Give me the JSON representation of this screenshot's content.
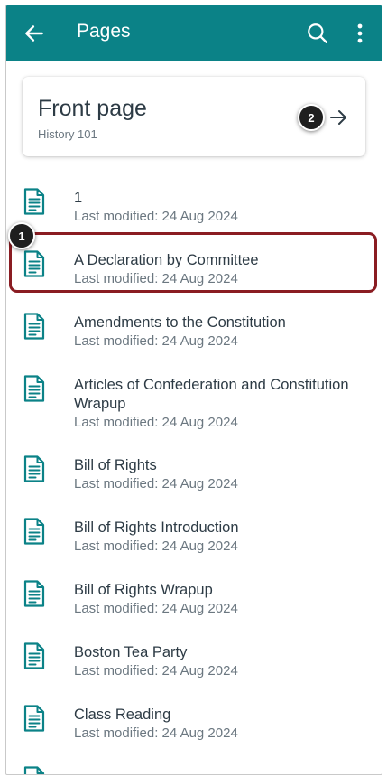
{
  "appbar": {
    "title": "Pages",
    "back_icon": "arrow-left-icon",
    "search_icon": "search-icon",
    "more_icon": "more-vertical-icon",
    "color": "#0b8287"
  },
  "front_page": {
    "title": "Front page",
    "subtitle": "History 101",
    "arrow_icon": "arrow-right-icon"
  },
  "callouts": {
    "one": "1",
    "two": "2"
  },
  "pages": [
    {
      "name": "1",
      "modified": "Last modified: 24 Aug 2024"
    },
    {
      "name": "A Declaration by Committee",
      "modified": "Last modified: 24 Aug 2024"
    },
    {
      "name": "Amendments to the Constitution",
      "modified": "Last modified: 24 Aug 2024"
    },
    {
      "name": "Articles of Confederation and Constitution Wrapup",
      "modified": "Last modified: 24 Aug 2024"
    },
    {
      "name": "Bill of Rights",
      "modified": "Last modified: 24 Aug 2024"
    },
    {
      "name": "Bill of Rights Introduction",
      "modified": "Last modified: 24 Aug 2024"
    },
    {
      "name": "Bill of Rights Wrapup",
      "modified": "Last modified: 24 Aug 2024"
    },
    {
      "name": "Boston Tea Party",
      "modified": "Last modified: 24 Aug 2024"
    },
    {
      "name": "Class Reading",
      "modified": "Last modified: 24 Aug 2024"
    }
  ]
}
